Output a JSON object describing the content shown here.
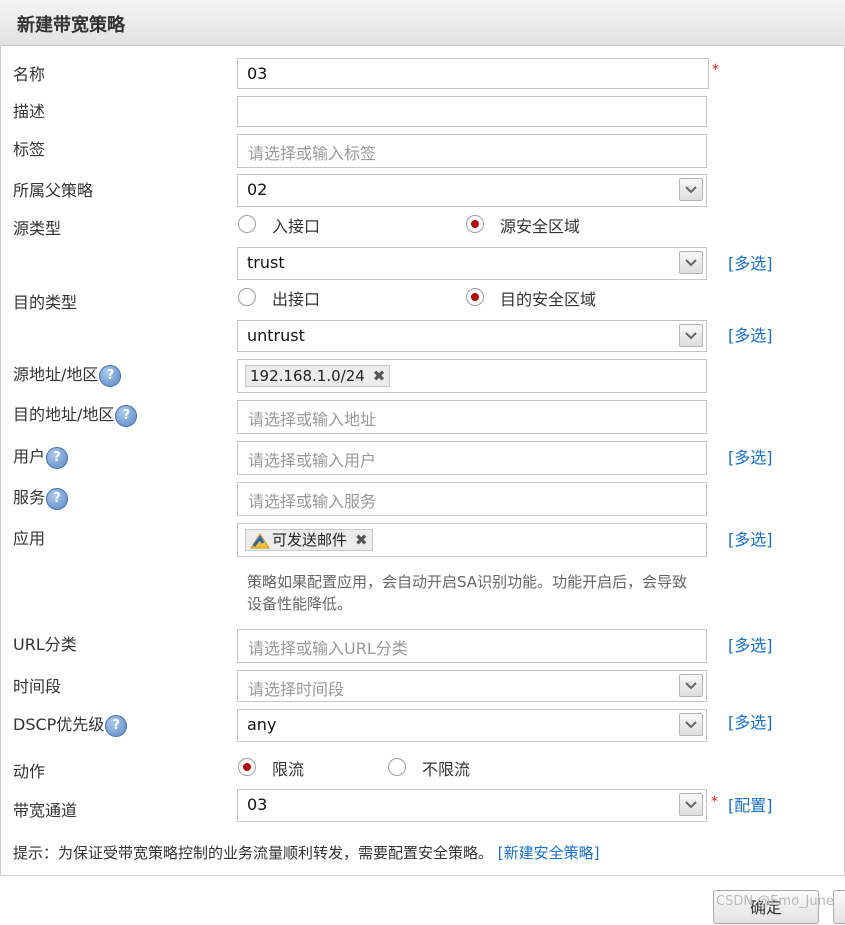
{
  "dialog": {
    "title": "新建带宽策略"
  },
  "form": {
    "name": {
      "label": "名称",
      "value": "03",
      "required": "*"
    },
    "description": {
      "label": "描述",
      "value": ""
    },
    "tag": {
      "label": "标签",
      "placeholder": "请选择或输入标签"
    },
    "parent_policy": {
      "label": "所属父策略",
      "value": "02"
    },
    "source_type": {
      "label": "源类型",
      "options": [
        "入接口",
        "源安全区域"
      ],
      "selected": "源安全区域",
      "value": "trust",
      "multi_link": "[多选]"
    },
    "dest_type": {
      "label": "目的类型",
      "options": [
        "出接口",
        "目的安全区域"
      ],
      "selected": "目的安全区域",
      "value": "untrust",
      "multi_link": "[多选]"
    },
    "source_address": {
      "label": "源地址/地区",
      "tags": [
        "192.168.1.0/24"
      ]
    },
    "dest_address": {
      "label": "目的地址/地区",
      "placeholder": "请选择或输入地址"
    },
    "user": {
      "label": "用户",
      "placeholder": "请选择或输入用户",
      "multi_link": "[多选]"
    },
    "service": {
      "label": "服务",
      "placeholder": "请选择或输入服务"
    },
    "application": {
      "label": "应用",
      "tags": [
        "可发送邮件"
      ],
      "multi_link": "[多选]",
      "note": "策略如果配置应用，会自动开启SA识别功能。功能开启后，会导致设备性能降低。"
    },
    "url_category": {
      "label": "URL分类",
      "placeholder": "请选择或输入URL分类",
      "multi_link": "[多选]"
    },
    "time_range": {
      "label": "时间段",
      "placeholder": "请选择时间段"
    },
    "dscp": {
      "label": "DSCP优先级",
      "value": "any",
      "multi_link": "[多选]"
    },
    "action": {
      "label": "动作",
      "options": [
        "限流",
        "不限流"
      ],
      "selected": "限流"
    },
    "bandwidth_channel": {
      "label": "带宽通道",
      "value": "03",
      "required": "*",
      "config_link": "[配置]"
    }
  },
  "hint": {
    "text": "提示：为保证受带宽策略控制的业务流量顺利转发，需要配置安全策略。",
    "link": "[新建安全策略]"
  },
  "buttons": {
    "ok": "确定"
  },
  "watermark": "CSDN @Emo_June",
  "help_icon_glyph": "?",
  "tag_remove_glyph": "✖",
  "colors": {
    "link": "#1a6fc7",
    "required": "#e02020",
    "radio_selected": "#b10d0d"
  }
}
